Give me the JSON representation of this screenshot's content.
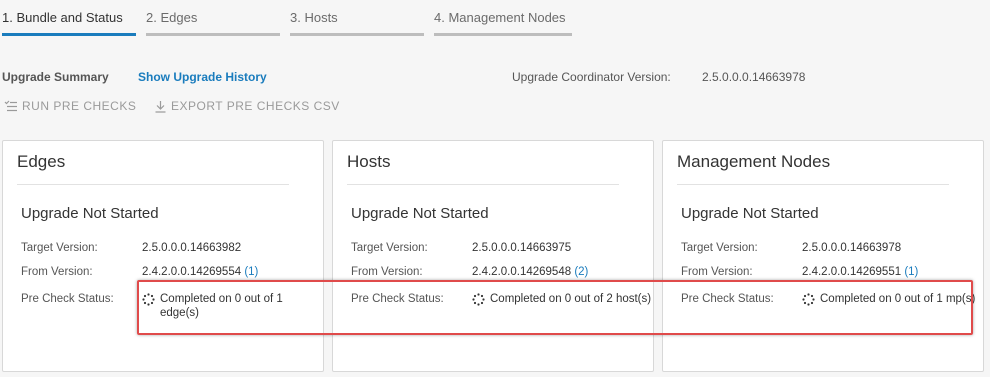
{
  "steps": [
    {
      "label": "1. Bundle and Status",
      "active": true
    },
    {
      "label": "2. Edges",
      "active": false
    },
    {
      "label": "3. Hosts",
      "active": false
    },
    {
      "label": "4. Management Nodes",
      "active": false
    }
  ],
  "summary": {
    "title": "Upgrade Summary",
    "history_link": "Show Upgrade History",
    "coordinator_label": "Upgrade Coordinator Version:",
    "coordinator_version": "2.5.0.0.0.14663978"
  },
  "toolbar": {
    "run_label": "RUN PRE CHECKS",
    "export_label": "EXPORT PRE CHECKS CSV"
  },
  "labels": {
    "target_version": "Target Version:",
    "from_version": "From Version:",
    "precheck_status": "Pre Check Status:"
  },
  "cards": [
    {
      "title": "Edges",
      "status": "Upgrade Not Started",
      "target_version": "2.5.0.0.0.14663982",
      "from_version": "2.4.2.0.0.14269554",
      "from_count": "(1)",
      "precheck": "Completed on 0 out of 1 edge(s)"
    },
    {
      "title": "Hosts",
      "status": "Upgrade Not Started",
      "target_version": "2.5.0.0.0.14663975",
      "from_version": "2.4.2.0.0.14269548",
      "from_count": "(2)",
      "precheck": "Completed on 0 out of 2 host(s)"
    },
    {
      "title": "Management Nodes",
      "status": "Upgrade Not Started",
      "target_version": "2.5.0.0.0.14663978",
      "from_version": "2.4.2.0.0.14269551",
      "from_count": "(1)",
      "precheck": "Completed on 0 out of 1 mp(s)"
    }
  ],
  "colors": {
    "accent": "#1a7cbd",
    "highlight": "#e04b4b"
  }
}
